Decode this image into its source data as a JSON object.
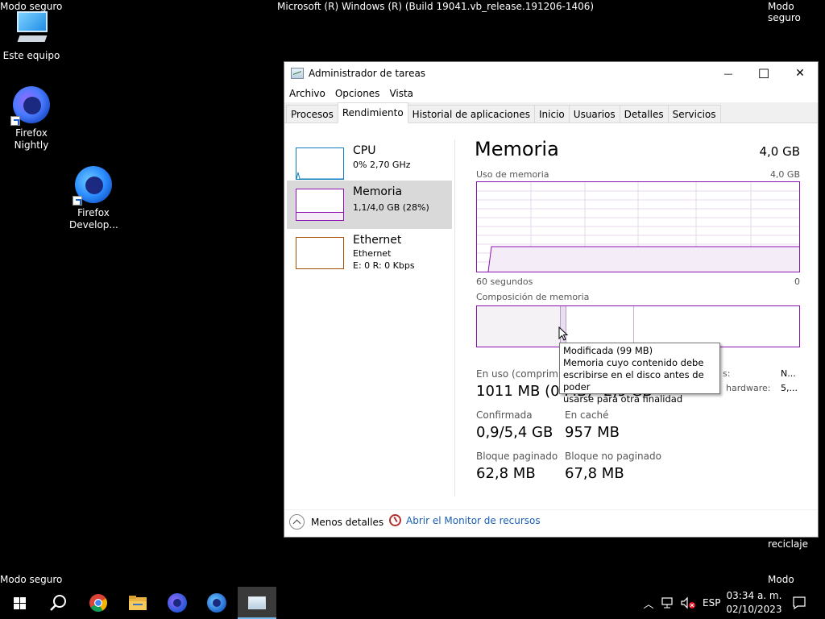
{
  "desktop": {
    "safe_mode_label": "Modo seguro",
    "build_text": "Microsoft (R) Windows (R) (Build 19041.vb_release.191206-1406)",
    "icons": [
      {
        "label": "Este equipo",
        "icon": "computer-icon"
      },
      {
        "label": "Firefox Nightly",
        "icon": "firefox-nightly-icon"
      },
      {
        "label": "Firefox Develop...",
        "icon": "firefox-developer-icon"
      }
    ],
    "recycle_label": "reciclaje"
  },
  "window": {
    "title": "Administrador de tareas",
    "controls": {
      "minimize": "—",
      "maximize": "☐",
      "close": "✕"
    },
    "menu": [
      "Archivo",
      "Opciones",
      "Vista"
    ],
    "tabs": [
      "Procesos",
      "Rendimiento",
      "Historial de aplicaciones",
      "Inicio",
      "Usuarios",
      "Detalles",
      "Servicios"
    ],
    "active_tab": "Rendimiento"
  },
  "sidebar": {
    "items": [
      {
        "name": "CPU",
        "line1": "0% 2,70 GHz",
        "line2": "",
        "color": "#117dbb"
      },
      {
        "name": "Memoria",
        "line1": "1,1/4,0 GB (28%)",
        "line2": "",
        "color": "#8b12ae"
      },
      {
        "name": "Ethernet",
        "line1": "Ethernet",
        "line2": "E: 0 R: 0 Kbps",
        "color": "#a74f01"
      }
    ],
    "selected": "Memoria"
  },
  "memory": {
    "title": "Memoria",
    "total": "4,0 GB",
    "usage_label": "Uso de memoria",
    "usage_max": "4,0 GB",
    "time_left": "60 segundos",
    "time_right": "0",
    "composition_label": "Composición de memoria",
    "in_use_label": "En uso (comprimid",
    "in_use_value": "1011 MB (0 MB)",
    "available_value": "2,9 GB",
    "right_label_1": "s:",
    "right_value_1": "N...",
    "right_label_2": "hardware:",
    "right_value_2": "5,...",
    "committed_label": "Confirmada",
    "committed_value": "0,9/5,4 GB",
    "cached_label": "En caché",
    "cached_value": "957 MB",
    "paged_label": "Bloque paginado",
    "paged_value": "62,8 MB",
    "nonpaged_label": "Bloque no paginado",
    "nonpaged_value": "67,8 MB",
    "usage_fraction": 0.28
  },
  "tooltip": {
    "title": "Modificada (99 MB)",
    "lines": [
      "Memoria cuyo contenido debe",
      "escribirse en el disco antes de poder",
      "usarse para otra finalidad"
    ]
  },
  "footer": {
    "fewer_details": "Menos detalles",
    "resource_monitor": "Abrir el Monitor de recursos"
  },
  "taskbar": {
    "apps": [
      "start-icon",
      "search-icon",
      "chrome-icon",
      "file-explorer-icon",
      "firefox-nightly-icon",
      "firefox-developer-icon",
      "task-manager-icon"
    ],
    "language": "ESP",
    "time": "03:34 a. m.",
    "date": "02/10/2023"
  }
}
